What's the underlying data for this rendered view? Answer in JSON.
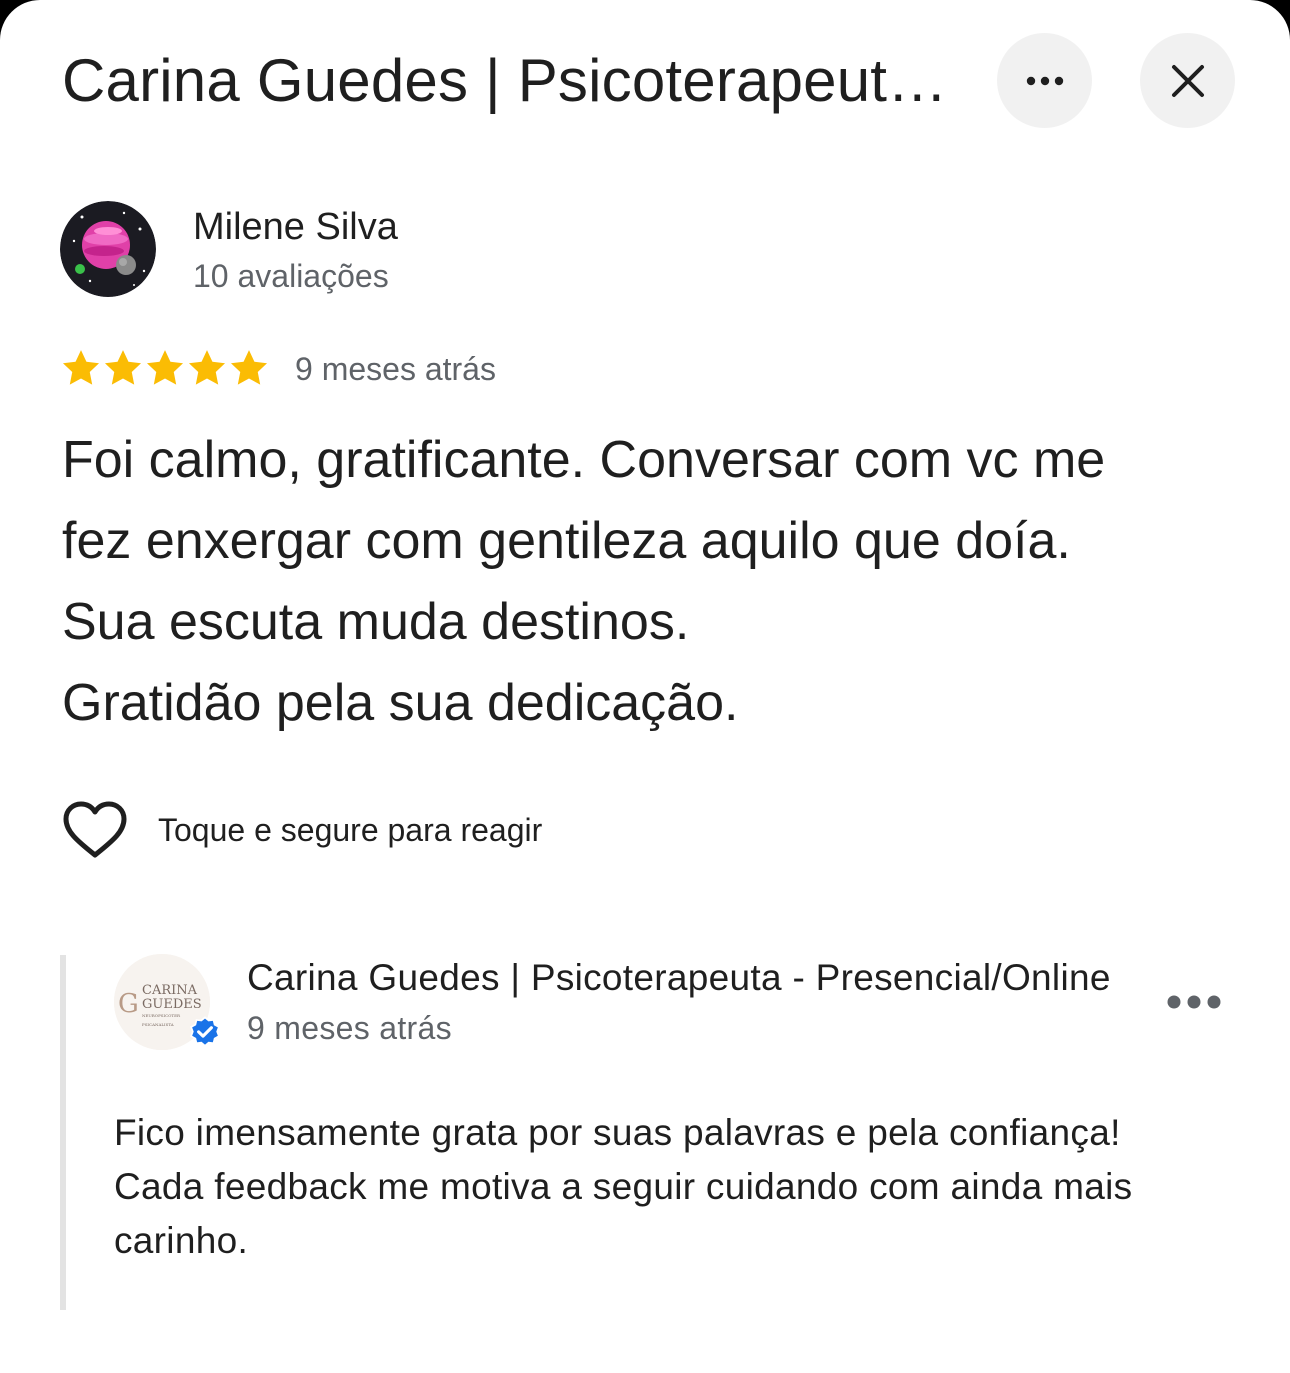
{
  "header": {
    "title": "Carina Guedes | Psicoterapeuta - Presencial/Online",
    "more_icon": "more-horiz-icon",
    "close_icon": "close-icon"
  },
  "review": {
    "author_name": "Milene Silva",
    "author_review_count": "10 avaliações",
    "rating": 5,
    "rating_max": 5,
    "star_color": "#fbbc04",
    "time": "9 meses atrás",
    "text_lines": [
      "Foi calmo, gratificante. Conversar com vc me",
      "fez enxergar com gentileza aquilo que doía.",
      "Sua escuta muda destinos.",
      "Gratidão pela sua dedicação."
    ],
    "react_label": "Toque e segure para reagir",
    "react_icon": "heart-outline-icon"
  },
  "owner_reply": {
    "name": "Carina Guedes | Psicoterapeuta - Presencial/Online",
    "time": "9 meses atrás",
    "verified_icon": "verified-badge-icon",
    "verified_color": "#1a73e8",
    "logo_text": {
      "line1": "CARINA",
      "line2": "GUEDES",
      "line3": "NEUROPSICOTERAPEUTA",
      "line4": "PSICANALISTA"
    },
    "text_lines": [
      "Fico imensamente grata por suas palavras e pela confiança!",
      "Cada feedback me motiva a seguir cuidando com ainda mais",
      "carinho."
    ]
  }
}
